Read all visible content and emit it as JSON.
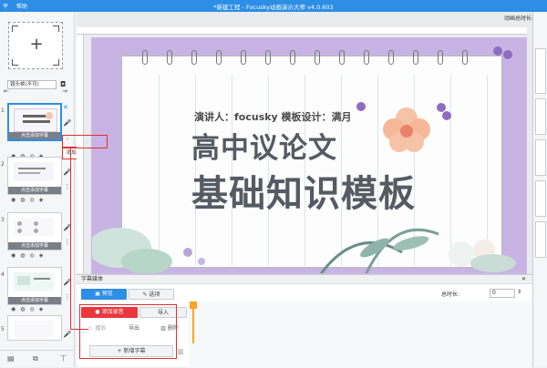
{
  "titlebar": {
    "menu": [
      "平",
      "帮助"
    ],
    "title": "*新建工程 - Focusky动画演示大师  v4.0.603"
  },
  "left": {
    "lens_select": "镜头帧(不可)",
    "slides": [
      {
        "num": "1",
        "bar": "点击添加字幕",
        "selected": true
      },
      {
        "num": "2",
        "bar": "点击添加字幕"
      },
      {
        "num": "3",
        "bar": "点击添加字幕"
      },
      {
        "num": "4",
        "bar": "点击添加字幕"
      },
      {
        "num": "5",
        "bar": ""
      }
    ],
    "tooltip": "添加声音跟字幕"
  },
  "topright": "动画总时长: 0",
  "slide": {
    "speaker": "演讲人：focusky    模板设计：满月",
    "line1": "高中议论文",
    "line2": "基础知识模板"
  },
  "subtitle_panel": {
    "title": "字幕媒体",
    "preview_label": "预览",
    "options_label": "选项",
    "record_label": "添加录音",
    "import_label": "导入",
    "play_label": "播放",
    "export_label": "导出",
    "delete_label": "删除",
    "total_label": "总时长:",
    "total_value": "0",
    "add_subtitle_label": "新增字幕"
  },
  "colors": {
    "accent": "#2d8ee6",
    "red": "#e8373d",
    "slide_frame": "#c7b3e4"
  }
}
